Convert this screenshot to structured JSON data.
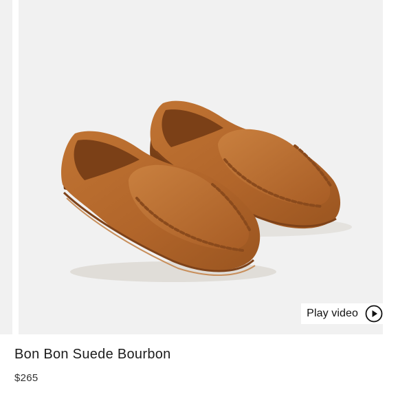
{
  "product": {
    "title": "Bon Bon Suede Bourbon",
    "price": "$265"
  },
  "gallery": {
    "image_subject": "suede-loafers",
    "play_video_label": "Play video",
    "play_icon": "play-circle-icon"
  },
  "colors": {
    "image_background": "#f1f1f1",
    "suede": "#b9692c",
    "text": "#1c1c1c"
  }
}
